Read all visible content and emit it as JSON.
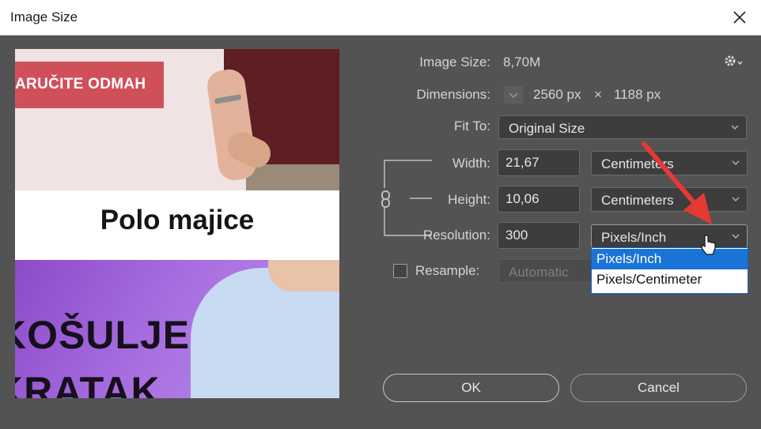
{
  "window": {
    "title": "Image Size"
  },
  "preview": {
    "banner_text": "NARUČITE ODMAH",
    "heading": "Polo majice",
    "line1": "KOŠULJE",
    "line2": "KRATAK"
  },
  "info": {
    "image_size_label": "Image Size:",
    "image_size_value": "8,70M",
    "dimensions_label": "Dimensions:",
    "dim_width": "2560 px",
    "dim_times": "×",
    "dim_height": "1188 px"
  },
  "fit_to": {
    "label": "Fit To:",
    "value": "Original Size"
  },
  "width": {
    "label": "Width:",
    "value": "21,67",
    "unit": "Centimeters"
  },
  "height": {
    "label": "Height:",
    "value": "10,06",
    "unit": "Centimeters"
  },
  "resolution": {
    "label": "Resolution:",
    "value": "300",
    "unit": "Pixels/Inch",
    "options": [
      "Pixels/Inch",
      "Pixels/Centimeter"
    ]
  },
  "resample": {
    "label": "Resample:",
    "checked": false,
    "method": "Automatic"
  },
  "buttons": {
    "ok": "OK",
    "cancel": "Cancel"
  },
  "colors": {
    "dialog_bg": "#535353",
    "highlight": "#1a74d8",
    "annotation_arrow": "#e53935"
  }
}
